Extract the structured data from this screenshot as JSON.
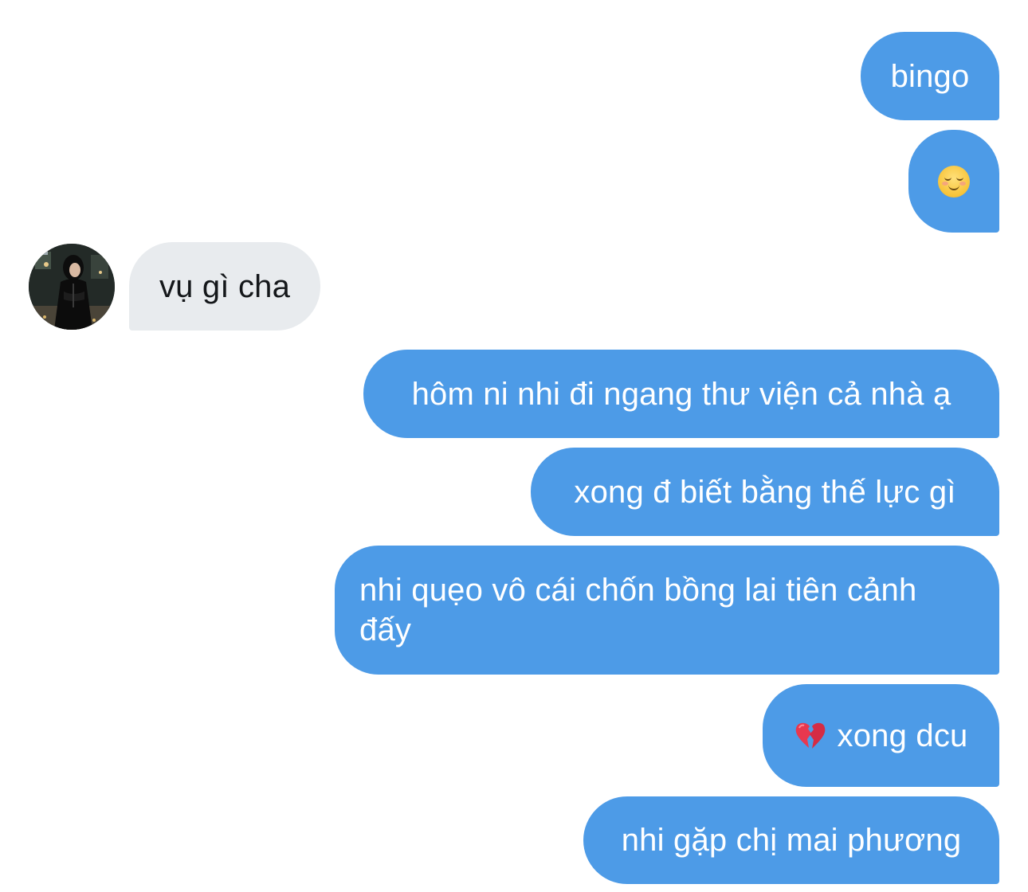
{
  "conversation": {
    "messages": [
      {
        "direction": "outgoing",
        "text": "bingo"
      },
      {
        "direction": "outgoing",
        "emoji": "relieved-smiling-face"
      },
      {
        "direction": "incoming",
        "text": "vụ gì cha",
        "avatar": "contact-avatar"
      },
      {
        "direction": "outgoing",
        "text": "hôm ni nhi đi ngang thư viện cả nhà ạ"
      },
      {
        "direction": "outgoing",
        "text": "xong đ biết bằng thế lực gì"
      },
      {
        "direction": "outgoing",
        "lines": [
          "nhi quẹo vô cái chốn bồng lai tiên cảnh",
          "đấy"
        ]
      },
      {
        "direction": "outgoing",
        "emoji": "broken-heart",
        "text": "xong dcu"
      },
      {
        "direction": "outgoing",
        "text": "nhi gặp chị mai phương"
      }
    ]
  },
  "colors": {
    "outgoing_bubble": "#4d9be7",
    "incoming_bubble": "#e8ebee",
    "outgoing_text": "#ffffff",
    "incoming_text": "#14171a"
  }
}
